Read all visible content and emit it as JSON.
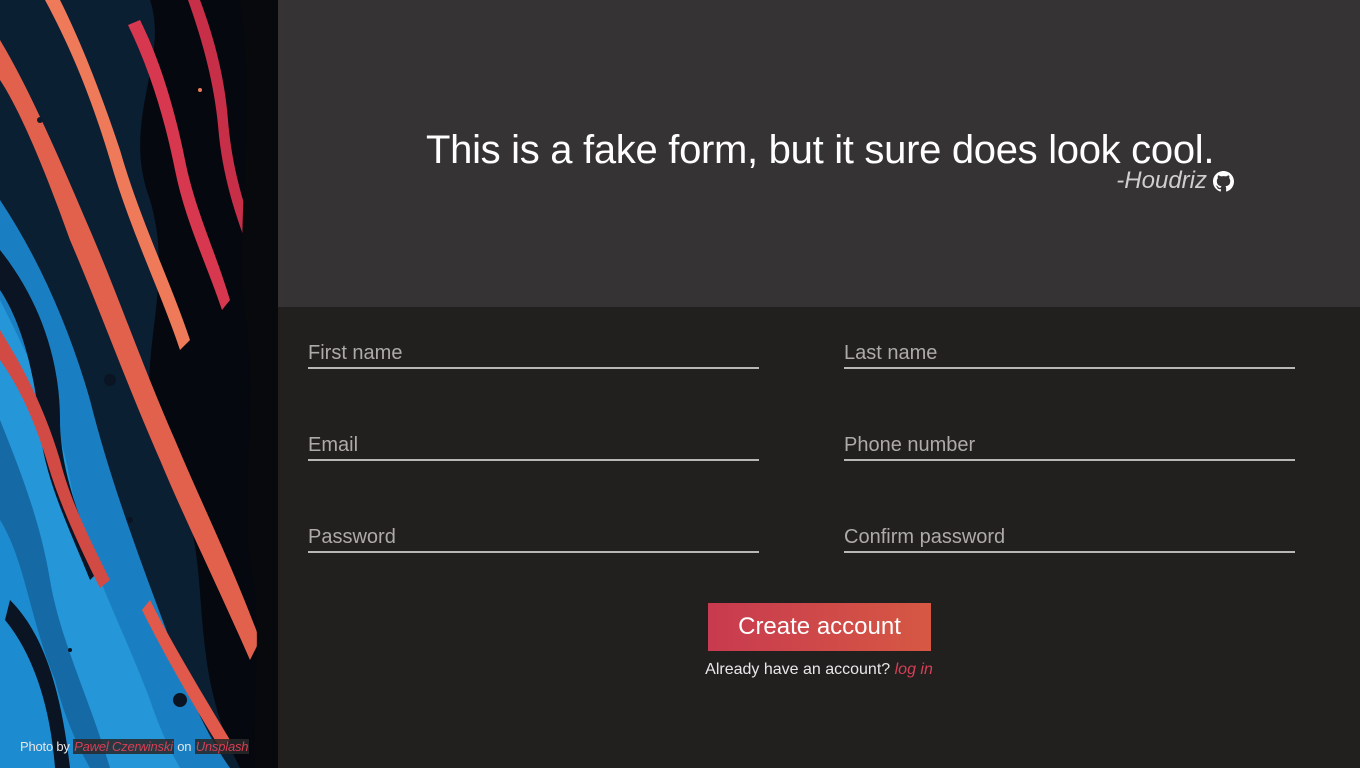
{
  "header": {
    "quote": "This is a fake form, but it sure does look cool.",
    "author": "-Houdriz",
    "author_icon": "github-icon"
  },
  "form": {
    "first_name_placeholder": "First name",
    "last_name_placeholder": "Last name",
    "email_placeholder": "Email",
    "phone_placeholder": "Phone number",
    "password_placeholder": "Password",
    "confirm_password_placeholder": "Confirm password",
    "submit_label": "Create account",
    "login_prompt": "Already have an account?",
    "login_link": "log in"
  },
  "photo_credit": {
    "prefix": "Photo by",
    "author": "Pawel Czerwinski",
    "middle": "on",
    "site": "Unsplash"
  },
  "colors": {
    "header_bg": "#363334",
    "form_bg": "#221f1f",
    "accent": "#d63f55",
    "button_start": "#c83a4f",
    "button_end": "#d65843"
  }
}
